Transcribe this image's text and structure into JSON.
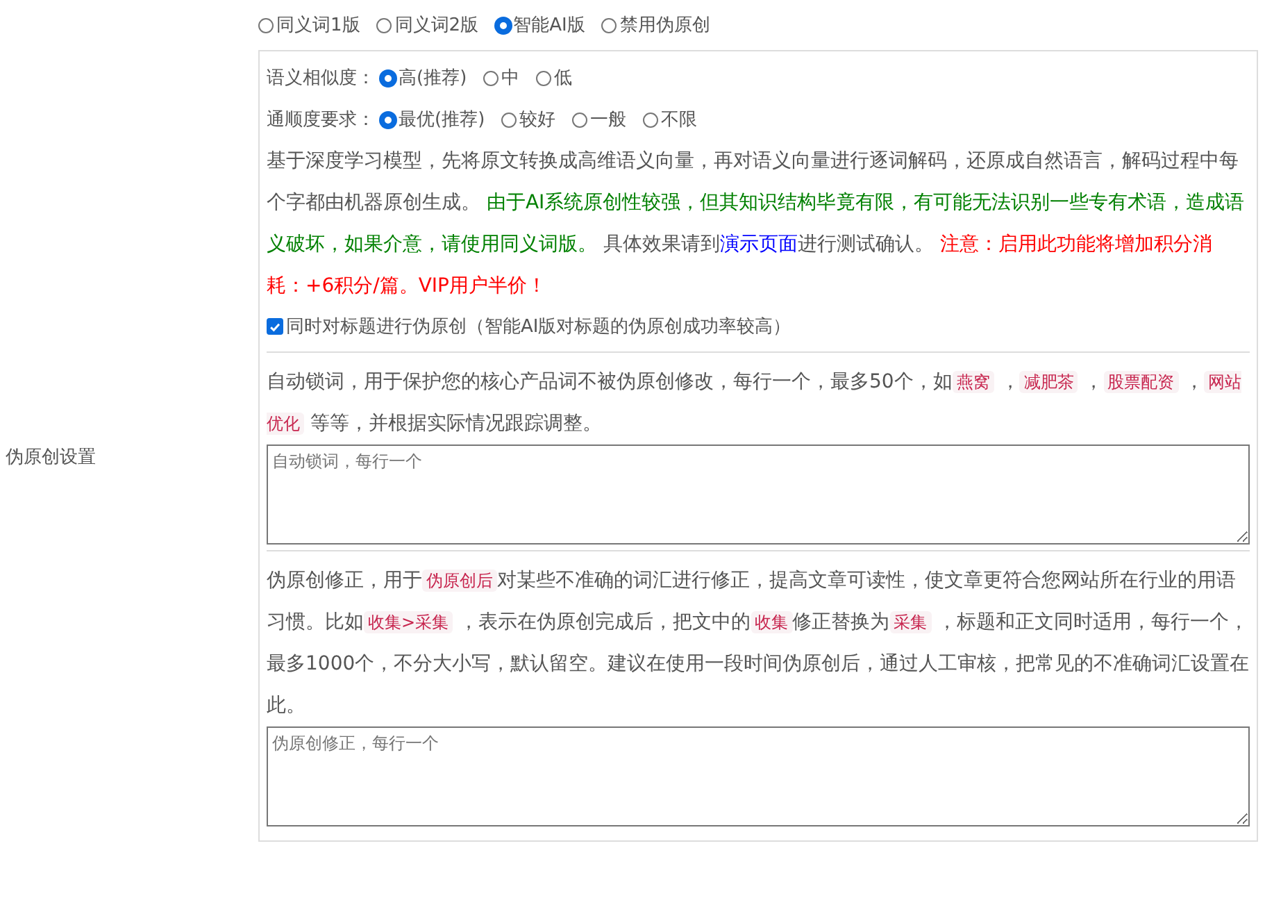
{
  "mode_options": [
    {
      "label": "同义词1版",
      "selected": false
    },
    {
      "label": "同义词2版",
      "selected": false
    },
    {
      "label": "智能AI版",
      "selected": true
    },
    {
      "label": "禁用伪原创",
      "selected": false
    }
  ],
  "similarity": {
    "label": "语义相似度：",
    "options": [
      {
        "label": "高(推荐)",
        "selected": true
      },
      {
        "label": "中",
        "selected": false
      },
      {
        "label": "低",
        "selected": false
      }
    ]
  },
  "fluency": {
    "label": "通顺度要求：",
    "options": [
      {
        "label": "最优(推荐)",
        "selected": true
      },
      {
        "label": "较好",
        "selected": false
      },
      {
        "label": "一般",
        "selected": false
      },
      {
        "label": "不限",
        "selected": false
      }
    ]
  },
  "ai_description": [
    {
      "kind": "text",
      "text": "基于深度学习模型，先将原文转换成高维语义向量，再对语义向量进行逐词解码，还原成自然语言，解码过程中每个字都由机器原创生成。 "
    },
    {
      "kind": "green",
      "text": "由于AI系统原创性较强，但其知识结构毕竟有限，有可能无法识别一些专有术语，造成语义破坏，如果介意，请使用同义词版。"
    },
    {
      "kind": "text",
      "text": " 具体效果请到"
    },
    {
      "kind": "link",
      "text": "演示页面"
    },
    {
      "kind": "text",
      "text": "进行测试确认。 "
    },
    {
      "kind": "red",
      "text": "注意：启用此功能将增加积分消耗：+6积分/篇。VIP用户半价！"
    }
  ],
  "title_checkbox": {
    "label": "同时对标题进行伪原创（智能AI版对标题的伪原创成功率较高）",
    "checked": true
  },
  "section_label": "伪原创设置",
  "lock_words": {
    "description": [
      {
        "kind": "text",
        "text": "自动锁词，用于保护您的核心产品词不被伪原创修改，每行一个，最多50个，如"
      },
      {
        "kind": "code",
        "text": "燕窝"
      },
      {
        "kind": "text",
        "text": " ，"
      },
      {
        "kind": "code",
        "text": "减肥茶"
      },
      {
        "kind": "text",
        "text": " ，"
      },
      {
        "kind": "code",
        "text": "股票配资"
      },
      {
        "kind": "text",
        "text": " ，"
      },
      {
        "kind": "code",
        "text": "网站优化"
      },
      {
        "kind": "text",
        "text": " 等等，并根据实际情况跟踪调整。"
      }
    ],
    "placeholder": "自动锁词，每行一个"
  },
  "corrections": {
    "description": [
      {
        "kind": "text",
        "text": "伪原创修正，用于"
      },
      {
        "kind": "code",
        "text": "伪原创后"
      },
      {
        "kind": "text",
        "text": "对某些不准确的词汇进行修正，提高文章可读性，使文章更符合您网站所在行业的用语习惯。比如"
      },
      {
        "kind": "code",
        "text": "收集>采集"
      },
      {
        "kind": "text",
        "text": " ，表示在伪原创完成后，把文中的"
      },
      {
        "kind": "code",
        "text": "收集"
      },
      {
        "kind": "text",
        "text": "修正替换为"
      },
      {
        "kind": "code",
        "text": "采集"
      },
      {
        "kind": "text",
        "text": " ，标题和正文同时适用，每行一个，最多1000个，不分大小写，默认留空。建议在使用一段时间伪原创后，通过人工审核，把常见的不准确词汇设置在此。"
      }
    ],
    "placeholder": "伪原创修正，每行一个"
  }
}
